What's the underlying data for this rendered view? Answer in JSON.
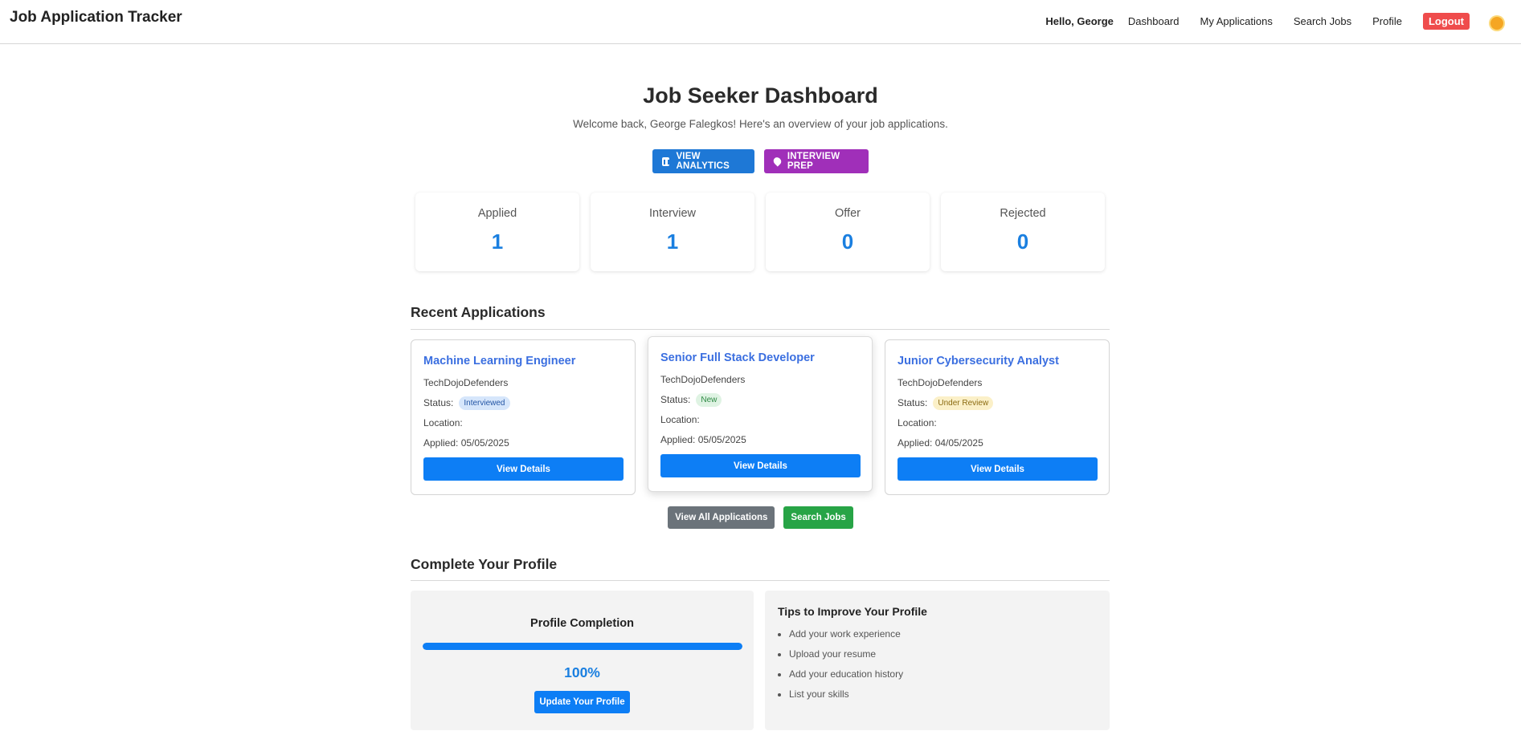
{
  "header": {
    "brand": "Job Application Tracker",
    "greeting": "Hello, George",
    "nav": [
      "Dashboard",
      "My Applications",
      "Search Jobs",
      "Profile"
    ],
    "logout": "Logout"
  },
  "hero": {
    "title": "Job Seeker Dashboard",
    "subtitle": "Welcome back, George Falegkos! Here's an overview of your job applications.",
    "analytics_label": "VIEW ANALYTICS",
    "prep_label": "INTERVIEW PREP"
  },
  "stats": [
    {
      "label": "Applied",
      "value": "1"
    },
    {
      "label": "Interview",
      "value": "1"
    },
    {
      "label": "Offer",
      "value": "0"
    },
    {
      "label": "Rejected",
      "value": "0"
    }
  ],
  "recent": {
    "title": "Recent Applications",
    "status_label": "Status:",
    "location_label": "Location:",
    "view_label": "View Details",
    "cards": [
      {
        "title": "Machine Learning Engineer",
        "company": "TechDojoDefenders",
        "status": "Interviewed",
        "location": "",
        "applied": "Applied: 05/05/2025"
      },
      {
        "title": "Senior Full Stack Developer",
        "company": "TechDojoDefenders",
        "status": "New",
        "location": "",
        "applied": "Applied: 05/05/2025"
      },
      {
        "title": "Junior Cybersecurity Analyst",
        "company": "TechDojoDefenders",
        "status": "Under Review",
        "location": "",
        "applied": "Applied: 04/05/2025"
      }
    ],
    "view_all": "View All Applications",
    "search_jobs": "Search Jobs"
  },
  "profile": {
    "section_title": "Complete Your Profile",
    "completion_title": "Profile Completion",
    "completion_value": "100%",
    "completion_fraction": 1.0,
    "update_button": "Update Your Profile",
    "tips_title": "Tips to Improve Your Profile",
    "tips": [
      "Add your work experience",
      "Upload your resume",
      "Add your education history",
      "List your skills"
    ]
  },
  "colors": {
    "primary": "#0d7ef5",
    "analytics": "#1e78d6",
    "prep": "#a02fb9",
    "logout": "#ef4c4c",
    "success": "#27a446",
    "secondary": "#6b737a"
  }
}
